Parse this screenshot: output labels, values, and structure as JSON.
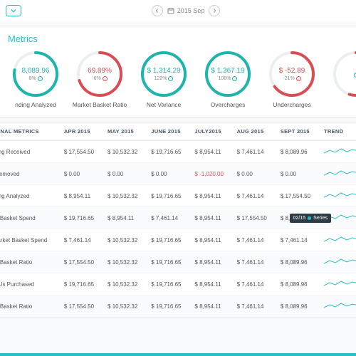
{
  "date_picker": {
    "label": "2015 Sep"
  },
  "section_title": "Metrics",
  "colors": {
    "teal": "#1fb5ad",
    "red": "#d94e55",
    "accent": "#27c0c7"
  },
  "metrics": [
    {
      "value": "8,089.96",
      "sub": "8%",
      "dir": "up",
      "color": "teal",
      "label": "nding Analyzed",
      "pct": 78
    },
    {
      "value": "69.89%",
      "sub": "-6%",
      "dir": "down",
      "color": "red",
      "label": "Market Basket Ratio",
      "pct": 70
    },
    {
      "value": "$ 1,314.29",
      "sub": "122%",
      "dir": "up",
      "color": "teal",
      "label": "Net Variance",
      "pct": 100
    },
    {
      "value": "$ 1,367.19",
      "sub": "108%",
      "dir": "up",
      "color": "teal",
      "label": "Overcharges",
      "pct": 100
    },
    {
      "value": "$ -52.89",
      "sub": "-21%",
      "dir": "down",
      "color": "red",
      "label": "Undercharges",
      "pct": 65
    },
    {
      "value": "",
      "sub": "",
      "dir": "up",
      "color": "red",
      "label": "",
      "pct": 55
    }
  ],
  "table": {
    "headers": [
      "TIONAL METRICS",
      "APR 2015",
      "MAY 2015",
      "JUNE 2015",
      "JULY2015",
      "AUG 2015",
      "SEPT 2015",
      "TREND"
    ],
    "rows": [
      {
        "label": "nding Received",
        "cells": [
          "$ 17,554.50",
          "$ 10,532.32",
          "$ 19,716.65",
          "$ 8,954.11",
          "$ 7,461.14",
          "$ 8,089.96"
        ]
      },
      {
        "label": "s Removed",
        "cells": [
          "$ 0.00",
          "$ 0.00",
          "$ 0.00",
          "$ -1,020.00",
          "$ 0.00",
          "$ 0.00"
        ],
        "negIdx": 3
      },
      {
        "label": "nding Analyzed",
        "cells": [
          "$ 8,954.11",
          "$ 10,532.32",
          "$ 19,716.65",
          "$ 8,954.11",
          "$ 7,461.14",
          "$ 17,554.50"
        ]
      },
      {
        "label": "ket Basket Spend",
        "cells": [
          "$ 19,716.65",
          "$ 8,954.11",
          "$ 7,461.14",
          "$ 8,954.11",
          "$ 17,554.50",
          "$ 8,089.96"
        ]
      },
      {
        "label": "-Market Basket Spend",
        "cells": [
          "$ 7,461.14",
          "$ 10,532.32",
          "$ 19,716.65",
          "$ 8,954.11",
          "$ 7,461.14",
          "$ 7,461.14"
        ]
      },
      {
        "label": "ket Basket Ratio",
        "cells": [
          "$ 17,554.50",
          "$ 10,532.32",
          "$ 19,716.65",
          "$ 8,954.11",
          "$ 7,461.14",
          "$ 8,089.96"
        ]
      },
      {
        "label": "SKUs Purchased",
        "cells": [
          "$ 19,716.65",
          "$ 10,532.32",
          "$ 19,716.65",
          "$ 8,954.11",
          "$ 7,461.14",
          "$ 8,089.96"
        ]
      },
      {
        "label": "ket Basket Ratio",
        "cells": [
          "$ 17,554.50",
          "$ 10,532.32",
          "$ 19,716.65",
          "$ 8,954.11",
          "$ 7,461.14",
          "$ 8,089.96"
        ]
      }
    ]
  },
  "tooltip": {
    "date": "02/15",
    "series": "Series"
  }
}
